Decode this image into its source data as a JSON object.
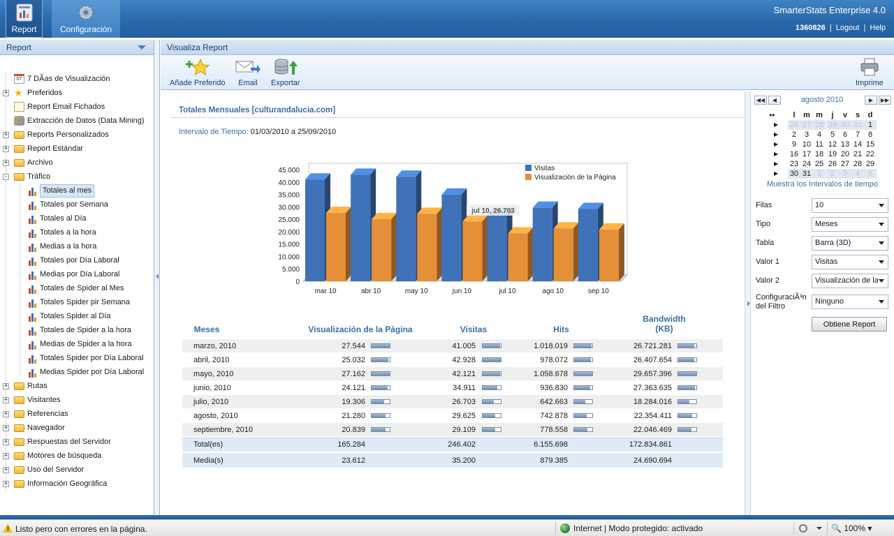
{
  "nav": {
    "report_label": "Report",
    "config_label": "Configuración"
  },
  "header": {
    "product": "SmarterStats Enterprise 4.0",
    "site_id": "1360826",
    "logout": "Logout",
    "help": "Help",
    "separator": "|"
  },
  "sidebar": {
    "title": "Report",
    "items": [
      {
        "label": "7 DÃ­as de Visualización",
        "icon": "calendar-icon",
        "level": 0,
        "expander": "none"
      },
      {
        "label": "Preferidos",
        "icon": "star-icon",
        "level": 0,
        "expander": "+"
      },
      {
        "label": "Report Email Fichados",
        "icon": "email-report-icon",
        "level": 0,
        "expander": "none"
      },
      {
        "label": "Extracción de Datos (Data Mining)",
        "icon": "data-mining-icon",
        "level": 0,
        "expander": "none"
      },
      {
        "label": "Reports Personalizados",
        "icon": "folder-icon",
        "level": 0,
        "expander": "+"
      },
      {
        "label": "Report Estándar",
        "icon": "folder-icon",
        "level": 0,
        "expander": "+"
      },
      {
        "label": "Archivo",
        "icon": "folder-icon",
        "level": 0,
        "expander": "+"
      },
      {
        "label": "Tráfico",
        "icon": "folder-open-icon",
        "level": 0,
        "expander": "-"
      },
      {
        "label": "Totales al mes",
        "icon": "bar-chart-icon",
        "level": 1,
        "expander": "none",
        "selected": true
      },
      {
        "label": "Totales por Semana",
        "icon": "bar-chart-icon",
        "level": 1,
        "expander": "none"
      },
      {
        "label": "Totales al Día",
        "icon": "bar-chart-icon",
        "level": 1,
        "expander": "none"
      },
      {
        "label": "Totales a la hora",
        "icon": "bar-chart-icon",
        "level": 1,
        "expander": "none"
      },
      {
        "label": "Medias a la hora",
        "icon": "bar-chart-icon",
        "level": 1,
        "expander": "none"
      },
      {
        "label": "Totales por Día Laboral",
        "icon": "bar-chart-icon",
        "level": 1,
        "expander": "none"
      },
      {
        "label": "Medias por Día Laboral",
        "icon": "bar-chart-icon",
        "level": 1,
        "expander": "none"
      },
      {
        "label": "Totales de Spider al Mes",
        "icon": "bar-chart-icon",
        "level": 1,
        "expander": "none"
      },
      {
        "label": "Totales Spider pir Semana",
        "icon": "bar-chart-icon",
        "level": 1,
        "expander": "none"
      },
      {
        "label": "Totales Spider al Día",
        "icon": "bar-chart-icon",
        "level": 1,
        "expander": "none"
      },
      {
        "label": "Totales de Spider a la hora",
        "icon": "bar-chart-icon",
        "level": 1,
        "expander": "none"
      },
      {
        "label": "Medias de Spider a la hora",
        "icon": "bar-chart-icon",
        "level": 1,
        "expander": "none"
      },
      {
        "label": "Totales Spider por Día Laboral",
        "icon": "bar-chart-icon",
        "level": 1,
        "expander": "none"
      },
      {
        "label": "Medias Spider por Día Laboral",
        "icon": "bar-chart-icon",
        "level": 1,
        "expander": "none"
      },
      {
        "label": "Rutas",
        "icon": "folder-icon",
        "level": 0,
        "expander": "+"
      },
      {
        "label": "Visitantes",
        "icon": "folder-icon",
        "level": 0,
        "expander": "+"
      },
      {
        "label": "Referencias",
        "icon": "folder-icon",
        "level": 0,
        "expander": "+"
      },
      {
        "label": "Navegador",
        "icon": "folder-icon",
        "level": 0,
        "expander": "+"
      },
      {
        "label": "Respuestas del Servidor",
        "icon": "folder-icon",
        "level": 0,
        "expander": "+"
      },
      {
        "label": "Motores de búsqueda",
        "icon": "folder-icon",
        "level": 0,
        "expander": "+"
      },
      {
        "label": "Uso del Servidor",
        "icon": "folder-icon",
        "level": 0,
        "expander": "+"
      },
      {
        "label": "Información Geográfica",
        "icon": "folder-icon",
        "level": 0,
        "expander": "+"
      }
    ]
  },
  "main": {
    "header": "Visualiza Report",
    "toolbar": {
      "add_favorite": "Añade Preferido",
      "email": "Email",
      "export": "Exportar",
      "print": "Imprime"
    },
    "report_title": "Totales Mensuales [culturandalucia.com]",
    "interval_label": "Intervalo de Tiempo:",
    "interval_value": "01/03/2010 a 25/09/2010"
  },
  "chart_data": {
    "type": "bar",
    "categories": [
      "mar 10",
      "abr 10",
      "may 10",
      "jun 10",
      "jul 10",
      "ago 10",
      "sep 10"
    ],
    "series": [
      {
        "name": "Visitas",
        "values": [
          41005,
          42928,
          42121,
          34911,
          26703,
          29625,
          29109
        ],
        "color": "#3f72b8"
      },
      {
        "name": "Visualización de la Página",
        "values": [
          27544,
          25032,
          27162,
          24121,
          19306,
          21280,
          20839
        ],
        "color": "#e58f38"
      }
    ],
    "y_ticks": [
      "45.000",
      "40.000",
      "35.000",
      "30.000",
      "25.000",
      "20.000",
      "15.000",
      "10.000",
      "5.000",
      "0"
    ],
    "ylim": [
      0,
      45000
    ],
    "tooltip": "jul 10, 26.703",
    "legend_position": "top-right",
    "style": "3d"
  },
  "table": {
    "headers": {
      "month": "Meses",
      "pageviews": "Visualización de la Página",
      "visits": "Visitas",
      "hits": "Hits",
      "bandwidth_1": "Bandwidth",
      "bandwidth_2": "(KB)"
    },
    "rows": [
      {
        "month": "marzo, 2010",
        "pageviews": "27.544",
        "visits": "41.005",
        "hits": "1.018.019",
        "bandwidth": "26.721.281",
        "pv_frac": 1.0,
        "vi_frac": 0.96,
        "hi_frac": 0.96,
        "bw_frac": 0.9
      },
      {
        "month": "abril, 2010",
        "pageviews": "25.032",
        "visits": "42.928",
        "hits": "978.072",
        "bandwidth": "26.407.654",
        "pv_frac": 0.91,
        "vi_frac": 1.0,
        "hi_frac": 0.92,
        "bw_frac": 0.89
      },
      {
        "month": "mayo, 2010",
        "pageviews": "27.162",
        "visits": "42.121",
        "hits": "1.058.678",
        "bandwidth": "29.657.396",
        "pv_frac": 0.99,
        "vi_frac": 0.98,
        "hi_frac": 1.0,
        "bw_frac": 1.0
      },
      {
        "month": "junio, 2010",
        "pageviews": "24.121",
        "visits": "34.911",
        "hits": "936.830",
        "bandwidth": "27.363.635",
        "pv_frac": 0.88,
        "vi_frac": 0.81,
        "hi_frac": 0.88,
        "bw_frac": 0.92
      },
      {
        "month": "julio, 2010",
        "pageviews": "19.306",
        "visits": "26.703",
        "hits": "642.663",
        "bandwidth": "18.284.016",
        "pv_frac": 0.7,
        "vi_frac": 0.62,
        "hi_frac": 0.61,
        "bw_frac": 0.62
      },
      {
        "month": "agosto, 2010",
        "pageviews": "21.280",
        "visits": "29.625",
        "hits": "742.878",
        "bandwidth": "22.354.411",
        "pv_frac": 0.77,
        "vi_frac": 0.69,
        "hi_frac": 0.7,
        "bw_frac": 0.75
      },
      {
        "month": "septiembre, 2010",
        "pageviews": "20.839",
        "visits": "29.109",
        "hits": "778.558",
        "bandwidth": "22.046.469",
        "pv_frac": 0.76,
        "vi_frac": 0.68,
        "hi_frac": 0.74,
        "bw_frac": 0.74
      }
    ],
    "total": {
      "label": "Total(es)",
      "pageviews": "165.284",
      "visits": "246.402",
      "hits": "6.155.698",
      "bandwidth": "172.834.861"
    },
    "average": {
      "label": "Media(s)",
      "pageviews": "23.612",
      "visits": "35.200",
      "hits": "879.385",
      "bandwidth": "24.690.694"
    }
  },
  "calendar": {
    "month": "agosto 2010",
    "day_headers": [
      "l",
      "m",
      "m",
      "j",
      "v",
      "s",
      "d"
    ],
    "weeks": [
      [
        {
          "d": "26",
          "dim": true
        },
        {
          "d": "27",
          "dim": true
        },
        {
          "d": "28",
          "dim": true
        },
        {
          "d": "29",
          "dim": true
        },
        {
          "d": "30",
          "dim": true
        },
        {
          "d": "31",
          "dim": true
        },
        {
          "d": "1",
          "dim": false
        }
      ],
      [
        {
          "d": "2",
          "dim": false
        },
        {
          "d": "3",
          "dim": false
        },
        {
          "d": "4",
          "dim": false
        },
        {
          "d": "5",
          "dim": false
        },
        {
          "d": "6",
          "dim": false
        },
        {
          "d": "7",
          "dim": false
        },
        {
          "d": "8",
          "dim": false
        }
      ],
      [
        {
          "d": "9",
          "dim": false
        },
        {
          "d": "10",
          "dim": false
        },
        {
          "d": "11",
          "dim": false
        },
        {
          "d": "12",
          "dim": false
        },
        {
          "d": "13",
          "dim": false
        },
        {
          "d": "14",
          "dim": false
        },
        {
          "d": "15",
          "dim": false
        }
      ],
      [
        {
          "d": "16",
          "dim": false
        },
        {
          "d": "17",
          "dim": false
        },
        {
          "d": "18",
          "dim": false
        },
        {
          "d": "19",
          "dim": false
        },
        {
          "d": "20",
          "dim": false
        },
        {
          "d": "21",
          "dim": false
        },
        {
          "d": "22",
          "dim": false
        }
      ],
      [
        {
          "d": "23",
          "dim": false
        },
        {
          "d": "24",
          "dim": false
        },
        {
          "d": "25",
          "dim": false
        },
        {
          "d": "26",
          "dim": false
        },
        {
          "d": "27",
          "dim": false
        },
        {
          "d": "28",
          "dim": false
        },
        {
          "d": "29",
          "dim": false
        }
      ],
      [
        {
          "d": "30",
          "dim": false
        },
        {
          "d": "31",
          "dim": false
        },
        {
          "d": "1",
          "dim": true
        },
        {
          "d": "2",
          "dim": true
        },
        {
          "d": "3",
          "dim": true
        },
        {
          "d": "4",
          "dim": true
        },
        {
          "d": "5",
          "dim": true
        }
      ]
    ],
    "show_intervals_link": "Muestra los Intervalos de tiempo"
  },
  "filters": {
    "rows_label": "Filas",
    "rows_value": "10",
    "type_label": "Tipo",
    "type_value": "Meses",
    "table_label": "Tabla",
    "table_value": "Barra (3D)",
    "value1_label": "Valor 1",
    "value1_value": "Visitas",
    "value2_label": "Valor 2",
    "value2_value": "Visualización de la Página",
    "filter_label_1": "ConfiguraciÃ³n",
    "filter_label_2": "del Filtro",
    "filter_value": "Ninguno",
    "submit": "Obtiene Report"
  },
  "statusbar": {
    "message": "Listo pero con errores en la página.",
    "zone": "Internet | Modo protegido: activado",
    "zoom": "100%"
  }
}
